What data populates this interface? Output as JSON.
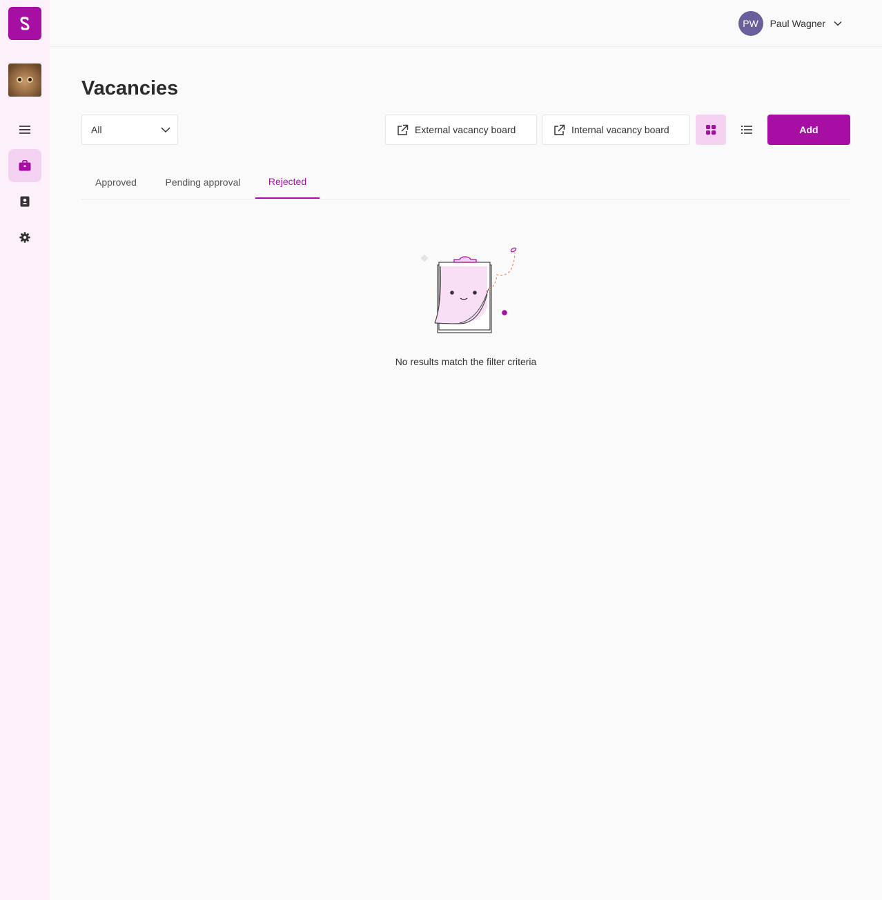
{
  "sidebar": {
    "logo": "logo-icon",
    "items": [
      {
        "icon": "menu-icon"
      },
      {
        "icon": "briefcase-icon",
        "active": true
      },
      {
        "icon": "contacts-icon"
      },
      {
        "icon": "gear-icon"
      }
    ]
  },
  "topbar": {
    "user": {
      "initials": "PW",
      "name": "Paul Wagner"
    }
  },
  "page": {
    "title": "Vacancies"
  },
  "toolbar": {
    "filter_value": "All",
    "external_board_label": "External vacancy board",
    "internal_board_label": "Internal vacancy board",
    "add_label": "Add"
  },
  "tabs": [
    {
      "label": "Approved",
      "active": false
    },
    {
      "label": "Pending approval",
      "active": false
    },
    {
      "label": "Rejected",
      "active": true
    }
  ],
  "empty_state": {
    "message": "No results match the filter criteria"
  },
  "colors": {
    "accent": "#a70ea3",
    "accent_light": "#f5d2f1",
    "sidebar_bg": "#fcf0fa",
    "avatar_bg": "#6a5f9b"
  }
}
